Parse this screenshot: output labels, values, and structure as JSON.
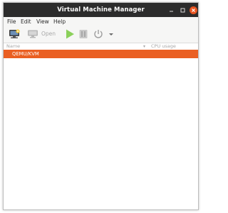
{
  "window": {
    "title": "Virtual Machine Manager"
  },
  "menubar": {
    "items": [
      "File",
      "Edit",
      "View",
      "Help"
    ]
  },
  "toolbar": {
    "open_label": "Open"
  },
  "columns": {
    "name": "Name",
    "cpu_usage": "CPU usage"
  },
  "connections": [
    {
      "label": "QEMU/KVM",
      "selected": true
    }
  ],
  "colors": {
    "titlebar": "#2c2c2c",
    "accent": "#ea5f22",
    "close_button": "#e95420",
    "play_icon": "#8bd05a"
  }
}
